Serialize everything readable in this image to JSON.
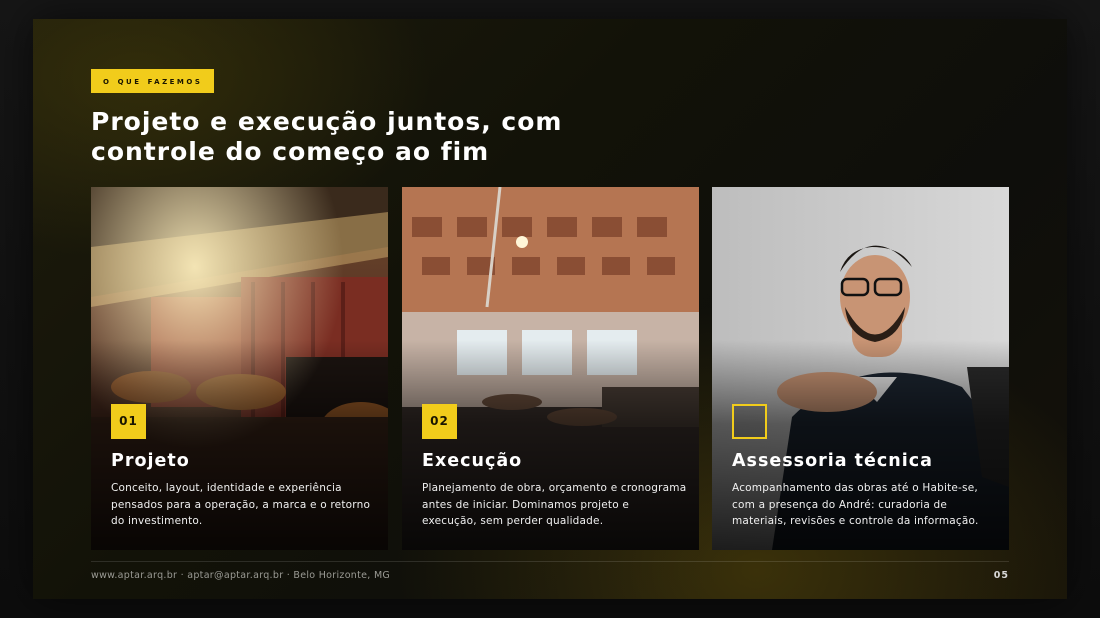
{
  "eyebrow": "O QUE FAZEMOS",
  "headline": "Projeto e execução juntos, com controle do começo ao fim",
  "cards": [
    {
      "number": "01",
      "title": "Projeto",
      "description": "Conceito, layout, identidade e experiência pensados para a operação, a marca e o retorno do investimento.",
      "image": "lounge-interior-photo"
    },
    {
      "number": "02",
      "title": "Execução",
      "description": "Planejamento de obra, orçamento e cronograma antes de iniciar. Dominamos projeto e execução, sem perder qualidade.",
      "image": "restaurant-interior-photo"
    },
    {
      "number": "",
      "title": "Assessoria técnica",
      "description": "Acompanhamento das obras até o Habite-se, com a presença do André: curadoria de materiais, revisões e controle da informação.",
      "image": "portrait-photo"
    }
  ],
  "footer": {
    "contact": "www.aptar.arq.br · aptar@aptar.arq.br · Belo Horizonte, MG",
    "page_number": "05"
  },
  "colors": {
    "accent": "#f1cc1b",
    "background": "#121208"
  }
}
